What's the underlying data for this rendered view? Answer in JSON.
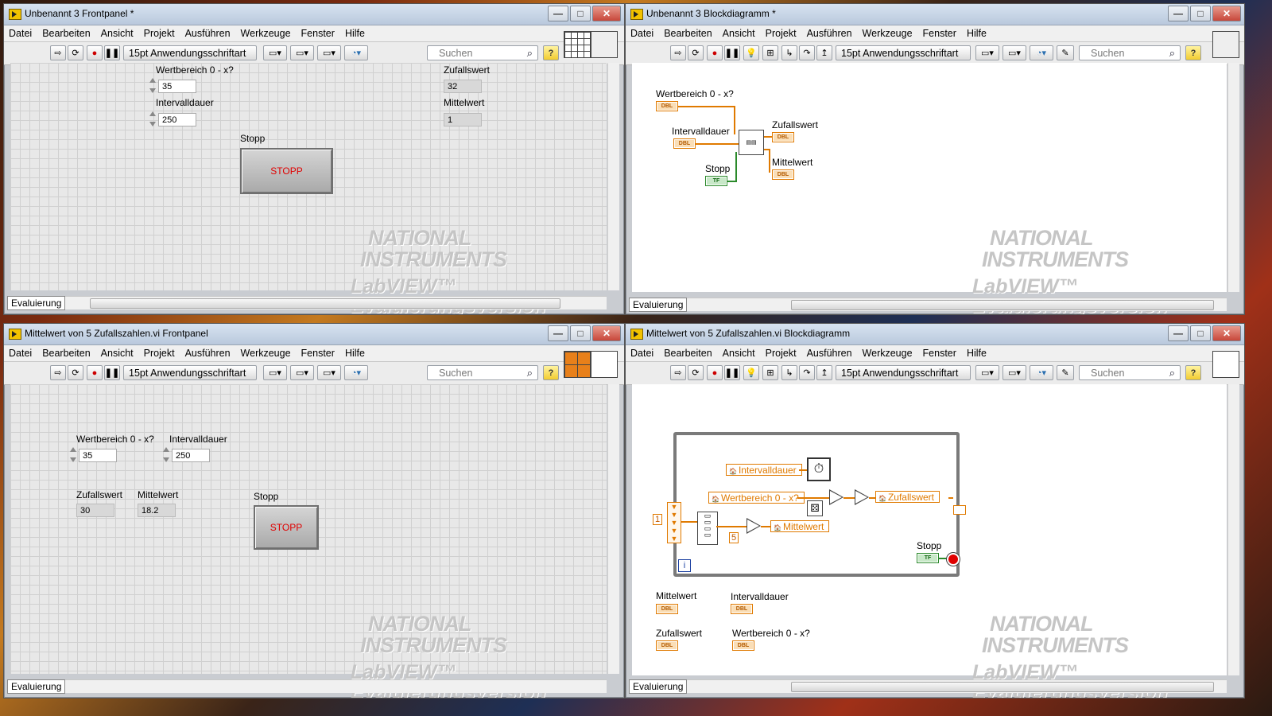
{
  "menu": [
    "Datei",
    "Bearbeiten",
    "Ansicht",
    "Projekt",
    "Ausführen",
    "Werkzeuge",
    "Fenster",
    "Hilfe"
  ],
  "toolbar": {
    "font": "15pt Anwendungsschriftart",
    "search_placeholder": "Suchen",
    "help": "?"
  },
  "status_tab": "Evaluierung",
  "watermark": {
    "line1": "NATIONAL",
    "line2": "INSTRUMENTS",
    "line3": "LabVIEW™ Evaluierungsversion"
  },
  "win1": {
    "title": "Unbenannt 3 Frontpanel *",
    "wertbereich_label": "Wertbereich 0 - x?",
    "wertbereich_value": "35",
    "intervall_label": "Intervalldauer",
    "intervall_value": "250",
    "zufall_label": "Zufallswert",
    "zufall_value": "32",
    "mittel_label": "Mittelwert",
    "mittel_value": "1",
    "stopp_label": "Stopp",
    "stopp_button": "STOPP"
  },
  "win2": {
    "title": "Unbenannt 3 Blockdiagramm *",
    "wertbereich_label": "Wertbereich 0 - x?",
    "intervall_label": "Intervalldauer",
    "zufall_label": "Zufallswert",
    "mittel_label": "Mittelwert",
    "stopp_label": "Stopp",
    "dbl": "DBL",
    "tf": "TF"
  },
  "win3": {
    "title": "Mittelwert von 5 Zufallszahlen.vi Frontpanel",
    "wertbereich_label": "Wertbereich 0 - x?",
    "wertbereich_value": "35",
    "intervall_label": "Intervalldauer",
    "intervall_value": "250",
    "zufall_label": "Zufallswert",
    "zufall_value": "30",
    "mittel_label": "Mittelwert",
    "mittel_value": "18.2",
    "stopp_label": "Stopp",
    "stopp_button": "STOPP"
  },
  "win4": {
    "title": "Mittelwert von 5 Zufallszahlen.vi Blockdiagramm",
    "local_intervall": "Intervalldauer",
    "local_wertbereich": "Wertbereich 0 - x?",
    "local_zufall": "Zufallswert",
    "local_mittel": "Mittelwert",
    "const_1": "1",
    "const_5": "5",
    "stopp_label": "Stopp",
    "iter": "i",
    "term_mittel_label": "Mittelwert",
    "term_intervall_label": "Intervalldauer",
    "term_zufall_label": "Zufallswert",
    "term_wertbereich_label": "Wertbereich 0 - x?",
    "dbl": "DBL",
    "tf": "TF"
  }
}
